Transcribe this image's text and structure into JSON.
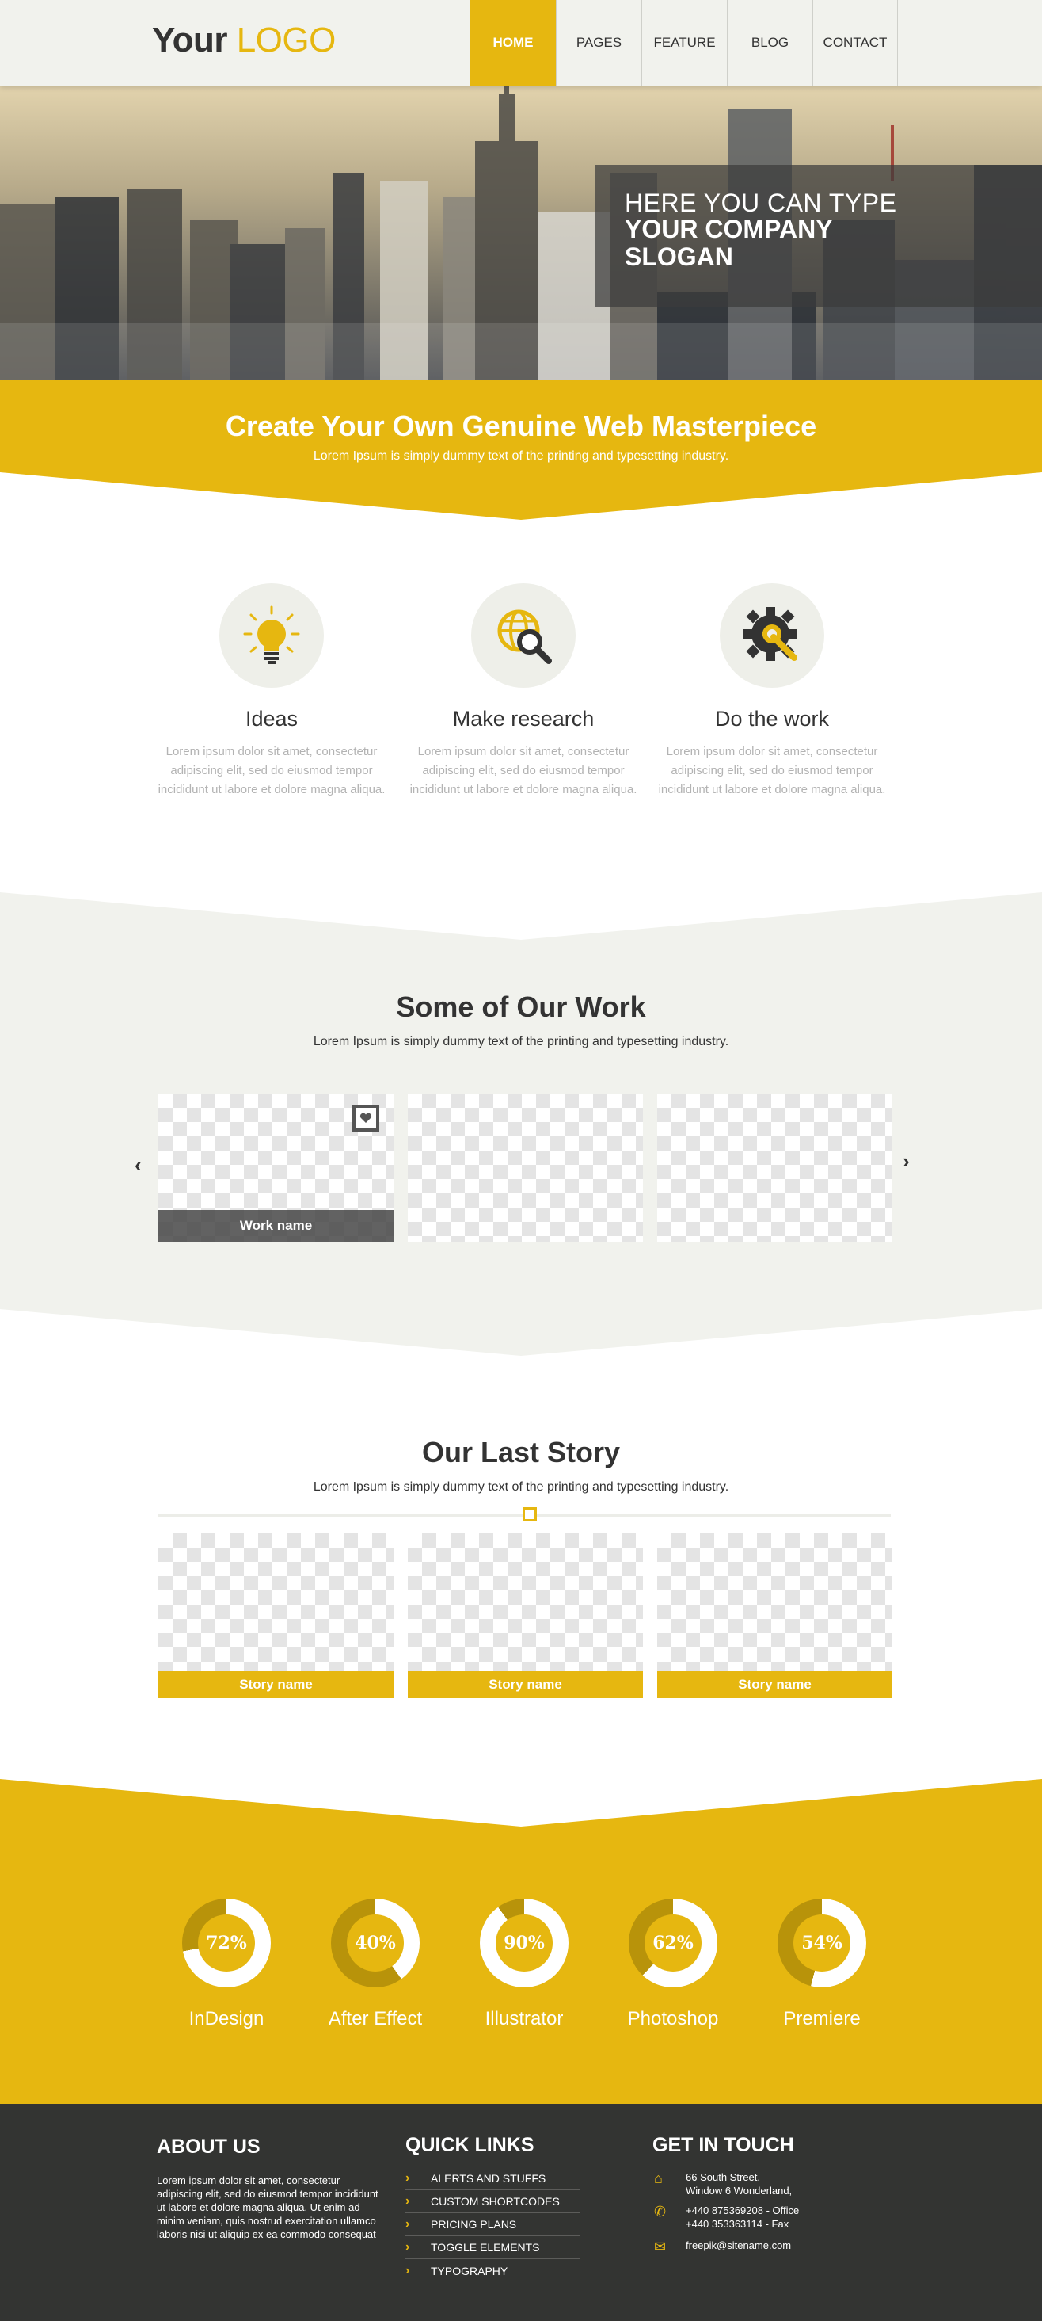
{
  "brand": {
    "logo_part1": "Your",
    "logo_part2": "LOGO",
    "accent_color": "#e6b710",
    "dark_color": "#333432",
    "light_bg": "#f1f2ed"
  },
  "nav": {
    "items": [
      "HOME",
      "PAGES",
      "FEATURE",
      "BLOG",
      "CONTACT"
    ],
    "active": "HOME"
  },
  "hero": {
    "slogan_line1": "HERE YOU CAN TYPE",
    "slogan_line2": "YOUR COMPANY SLOGAN"
  },
  "intro": {
    "title": "Create Your Own Genuine Web Masterpiece",
    "subtitle": "Lorem Ipsum is simply dummy text of the printing and typesetting industry."
  },
  "features": [
    {
      "icon": "lightbulb-icon",
      "title": "Ideas",
      "text": "Lorem ipsum dolor sit amet, consectetur adipiscing elit, sed do eiusmod tempor incididunt ut labore et dolore magna aliqua."
    },
    {
      "icon": "globe-search-icon",
      "title": "Make research",
      "text": "Lorem ipsum dolor sit amet, consectetur adipiscing elit, sed do eiusmod tempor incididunt ut labore et dolore magna aliqua."
    },
    {
      "icon": "gear-wrench-icon",
      "title": "Do the work",
      "text": "Lorem ipsum dolor sit amet, consectetur adipiscing elit, sed do eiusmod tempor incididunt ut labore et dolore magna aliqua."
    }
  ],
  "work": {
    "title": "Some of Our Work",
    "subtitle": "Lorem Ipsum is simply dummy text of the printing and typesetting industry.",
    "items": [
      {
        "caption": "Work name"
      },
      {
        "caption": ""
      },
      {
        "caption": ""
      }
    ]
  },
  "story": {
    "title": "Our Last Story",
    "subtitle": "Lorem Ipsum is simply dummy text of the printing and typesetting industry.",
    "items": [
      {
        "caption": "Story name"
      },
      {
        "caption": "Story name"
      },
      {
        "caption": "Story name"
      }
    ]
  },
  "skills": [
    {
      "name": "InDesign",
      "percent": 72,
      "label": "72%"
    },
    {
      "name": "After Effect",
      "percent": 40,
      "label": "40%"
    },
    {
      "name": "Illustrator",
      "percent": 90,
      "label": "90%"
    },
    {
      "name": "Photoshop",
      "percent": 62,
      "label": "62%"
    },
    {
      "name": "Premiere",
      "percent": 54,
      "label": "54%"
    }
  ],
  "footer": {
    "about_title": "ABOUT US",
    "about_text": "Lorem ipsum dolor sit amet, consectetur adipiscing elit, sed do eiusmod tempor incididunt ut labore et dolore magna aliqua. Ut enim ad minim veniam, quis nostrud exercitation ullamco laboris nisi ut aliquip ex ea commodo consequat",
    "links_title": "QUICK LINKS",
    "links": [
      "ALERTS AND STUFFS",
      "CUSTOM SHORTCODES",
      "PRICING PLANS",
      "TOGGLE ELEMENTS",
      "TYPOGRAPHY"
    ],
    "contact_title": "GET IN TOUCH",
    "address_line1": "66 South Street,",
    "address_line2": "Window 6 Wonderland,",
    "phone_office": "+440 875369208 - Office",
    "phone_fax": "+440 353363114 - Fax",
    "email": "freepik@sitename.com"
  }
}
